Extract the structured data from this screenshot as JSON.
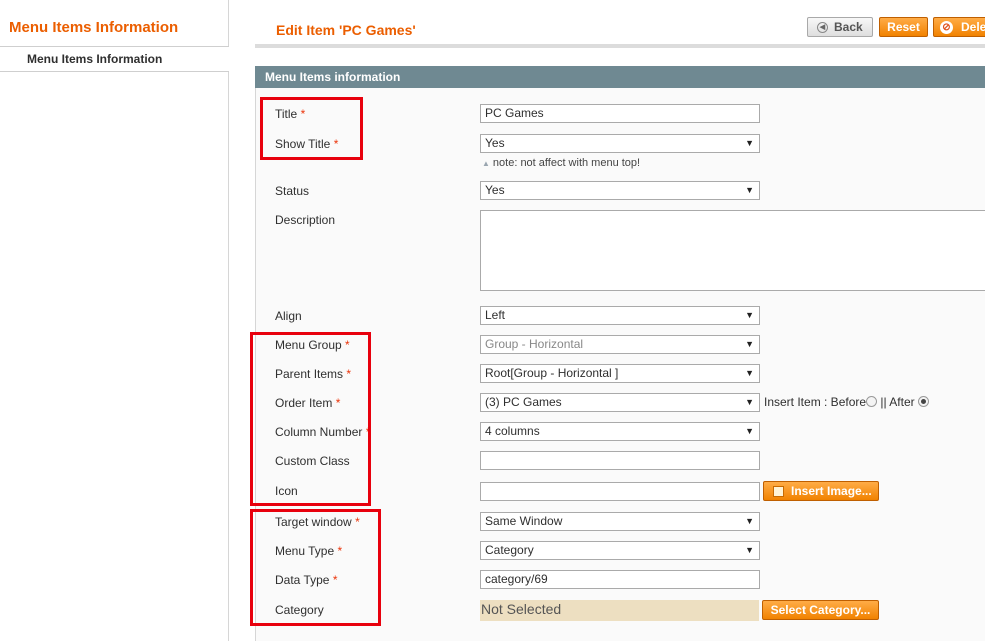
{
  "sidebar": {
    "title": "Menu Items Information",
    "items": [
      {
        "label": "Menu Items Information"
      }
    ]
  },
  "header": {
    "title": "Edit Item 'PC Games'",
    "back_label": "Back",
    "reset_label": "Reset",
    "delete_label": "Dele"
  },
  "section": {
    "title": "Menu Items information"
  },
  "form": {
    "title_label": "Title",
    "title_value": "PC Games",
    "show_title_label": "Show Title",
    "show_title_value": "Yes",
    "note": "note: not affect with menu top!",
    "status_label": "Status",
    "status_value": "Yes",
    "description_label": "Description",
    "align_label": "Align",
    "align_value": "Left",
    "menu_group_label": "Menu Group",
    "menu_group_value": "Group - Horizontal",
    "parent_items_label": "Parent Items",
    "parent_items_value": "Root[Group - Horizontal ]",
    "order_item_label": "Order Item",
    "order_item_value": "(3) PC Games",
    "insert_item_label": "Insert Item : Before",
    "insert_item_sep": "|| After",
    "insert_item_selected": "After",
    "column_number_label": "Column Number",
    "column_number_value": "4 columns",
    "custom_class_label": "Custom Class",
    "custom_class_value": "",
    "icon_label": "Icon",
    "icon_value": "",
    "insert_image_label": "Insert Image...",
    "target_window_label": "Target window",
    "target_window_value": "Same Window",
    "menu_type_label": "Menu Type",
    "menu_type_value": "Category",
    "data_type_label": "Data Type",
    "data_type_value": "category/69",
    "category_label": "Category",
    "category_value": "Not Selected",
    "select_category_label": "Select Category...",
    "required_mark": "*"
  },
  "icons": {
    "back": "back-arrow-icon",
    "delete": "delete-icon",
    "insert_image": "image-icon",
    "select_arrow": "chevron-down-icon",
    "note": "triangle-up-icon"
  },
  "colors": {
    "accent": "#eb5e00",
    "section_header": "#6f8992",
    "button_orange": "#f18200",
    "highlight_red": "#e8000d",
    "category_bg": "#eddfc1"
  }
}
